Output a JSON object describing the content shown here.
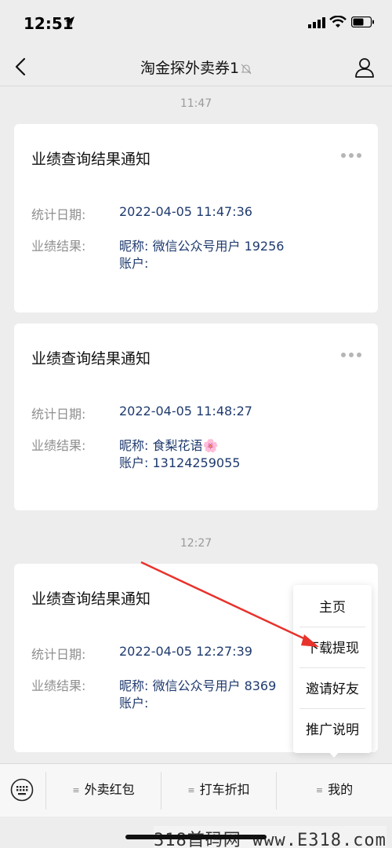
{
  "status_bar": {
    "time": "12:51",
    "icons": [
      "location-arrow-icon",
      "signal-icon",
      "wifi-icon",
      "battery-icon"
    ]
  },
  "nav": {
    "title": "淘金探外卖券1",
    "icons": [
      "back-icon",
      "mute-icon",
      "profile-icon"
    ]
  },
  "messages": [
    {
      "time": "11:47",
      "title": "业绩查询结果通知",
      "date_label": "统计日期:",
      "date_value": "2022-04-05 11:47:36",
      "result_label": "业绩结果:",
      "nickname_line": "昵称: 微信公众号用户 19256",
      "account_line": "账户:"
    },
    {
      "title": "业绩查询结果通知",
      "date_label": "统计日期:",
      "date_value": "2022-04-05 11:48:27",
      "result_label": "业绩结果:",
      "nickname_line": "昵称: 食梨花语",
      "nickname_emoji": "🌸",
      "account_line": "账户: 13124259055"
    },
    {
      "time": "12:27",
      "title": "业绩查询结果通知",
      "date_label": "统计日期:",
      "date_value": "2022-04-05 12:27:39",
      "result_label": "业绩结果:",
      "nickname_line": "昵称: 微信公众号用户 8369",
      "account_line": "账户:"
    }
  ],
  "popup_menu": {
    "items": [
      "主页",
      "下载提现",
      "邀请好友",
      "推广说明"
    ]
  },
  "bottom_menu": {
    "items": [
      "外卖红包",
      "打车折扣",
      "我的"
    ],
    "glyph": "≡"
  },
  "watermark": "318首码网 www.E318.com",
  "colors": {
    "background": "#ededed",
    "card": "#ffffff",
    "value_text": "#1f3a6e",
    "label_text": "#8f8f8f",
    "annotation_arrow": "#e8322b"
  }
}
